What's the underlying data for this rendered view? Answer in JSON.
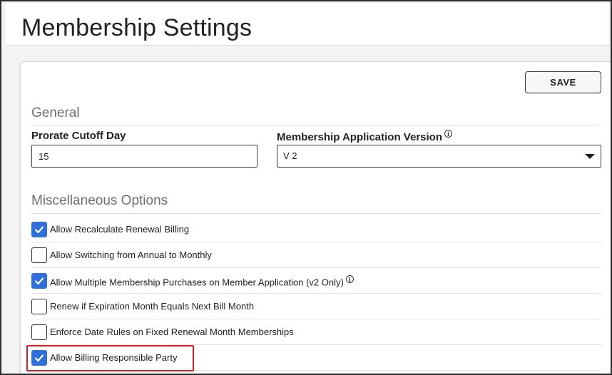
{
  "page": {
    "title": "Membership Settings"
  },
  "toolbar": {
    "save_label": "SAVE"
  },
  "general": {
    "section_title": "General",
    "prorate": {
      "label": "Prorate Cutoff Day",
      "value": "15"
    },
    "app_version": {
      "label": "Membership Application Version",
      "info_icon": "info-icon",
      "selected": "V 2"
    }
  },
  "misc": {
    "section_title": "Miscellaneous Options",
    "options": [
      {
        "label": "Allow Recalculate Renewal Billing",
        "checked": true
      },
      {
        "label": "Allow Switching from Annual to Monthly",
        "checked": false
      },
      {
        "label": "Allow Multiple Membership Purchases on Member Application (v2 Only)",
        "checked": true,
        "info_icon": "info-icon"
      },
      {
        "label": "Renew if Expiration Month Equals Next Bill Month",
        "checked": false
      },
      {
        "label": "Enforce Date Rules on Fixed Renewal Month Memberships",
        "checked": false
      },
      {
        "label": "Allow Billing Responsible Party",
        "checked": true,
        "highlighted": true
      }
    ]
  },
  "colors": {
    "checkbox_checked": "#2f6fdb",
    "highlight": "#d81e2c"
  }
}
